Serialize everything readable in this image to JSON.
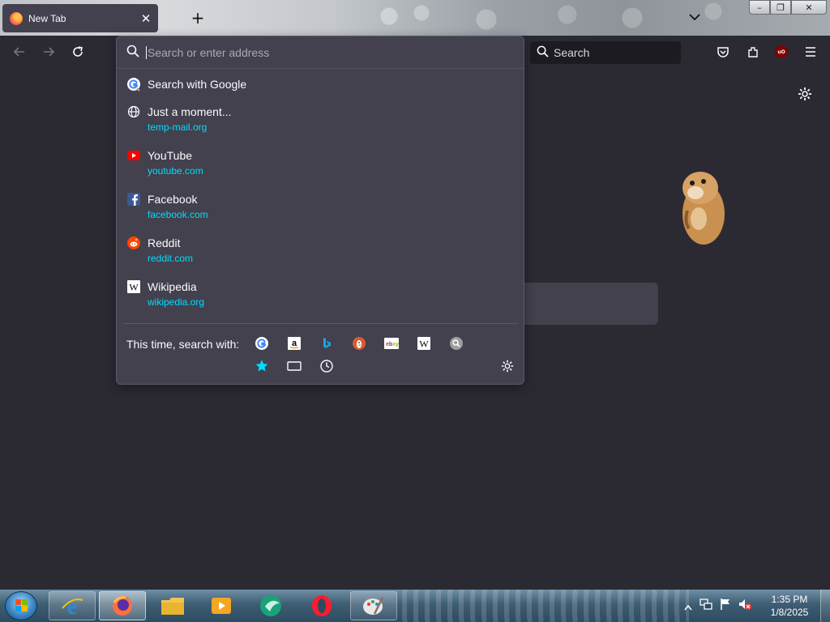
{
  "tab": {
    "title": "New Tab",
    "close_glyph": "✕"
  },
  "newtab_glyph": "+",
  "window_controls": {
    "minimize": "–",
    "maximize": "❐",
    "close": "✕"
  },
  "navbar": {
    "search_label": "Search"
  },
  "urlbar": {
    "placeholder": "Search or enter address",
    "results": [
      {
        "title": "Search with Google",
        "url": "",
        "icon": "google-icon"
      },
      {
        "title": "Just a moment...",
        "url": "temp-mail.org",
        "icon": "globe-icon"
      },
      {
        "title": "YouTube",
        "url": "youtube.com",
        "icon": "youtube-icon"
      },
      {
        "title": "Facebook",
        "url": "facebook.com",
        "icon": "facebook-icon"
      },
      {
        "title": "Reddit",
        "url": "reddit.com",
        "icon": "reddit-icon"
      },
      {
        "title": "Wikipedia",
        "url": "wikipedia.org",
        "icon": "wikipedia-icon"
      }
    ],
    "oneoff_label": "This time, search with:",
    "engines": [
      "google",
      "amazon",
      "bing",
      "duckduckgo",
      "ebay",
      "wikipedia",
      "search"
    ],
    "modes": [
      "bookmarks",
      "tabs",
      "history"
    ]
  },
  "taskbar": {
    "apps": [
      "internet-explorer",
      "firefox",
      "file-explorer",
      "media-player",
      "app-teal",
      "opera",
      "paint"
    ],
    "clock_time": "1:35 PM",
    "clock_date": "1/8/2025"
  },
  "colors": {
    "accent": "#00ddff",
    "panel": "#42414d",
    "background": "#2b2a33"
  }
}
